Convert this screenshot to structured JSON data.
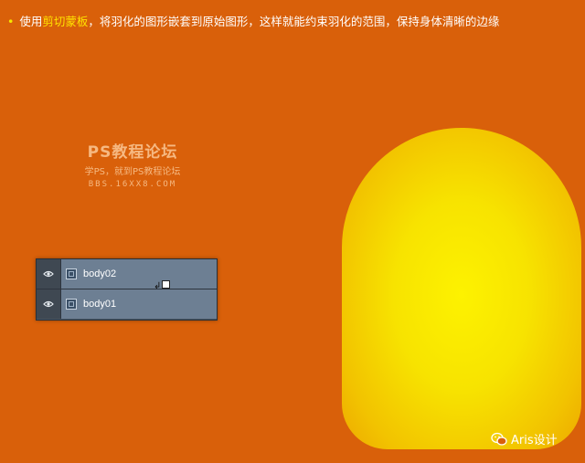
{
  "instruction": {
    "bullet": "•",
    "prefix": "使用",
    "highlight": "剪切蒙板",
    "suffix": "，将羽化的图形嵌套到原始图形，这样就能约束羽化的范围，保持身体清晰的边缘"
  },
  "watermark": {
    "title": "PS教程论坛",
    "subtitle": "学PS，就到PS教程论坛",
    "url": "BBS.16XX8.COM"
  },
  "layers": [
    {
      "name": "body02",
      "visible": true
    },
    {
      "name": "body01",
      "visible": true
    }
  ],
  "footer": {
    "brand": "Aris设计"
  },
  "colors": {
    "background": "#d9600a",
    "highlight": "#ffe200",
    "capsule_center": "#fdf200",
    "capsule_edge": "#eca400",
    "layer_row": "#6d7f93"
  },
  "icons": {
    "visibility": "eye-icon",
    "layer_thumbnail": "layer-thumbnail-icon",
    "clipping_cursor": "clipping-mask-cursor-icon",
    "footer_logo": "wechat-icon"
  }
}
